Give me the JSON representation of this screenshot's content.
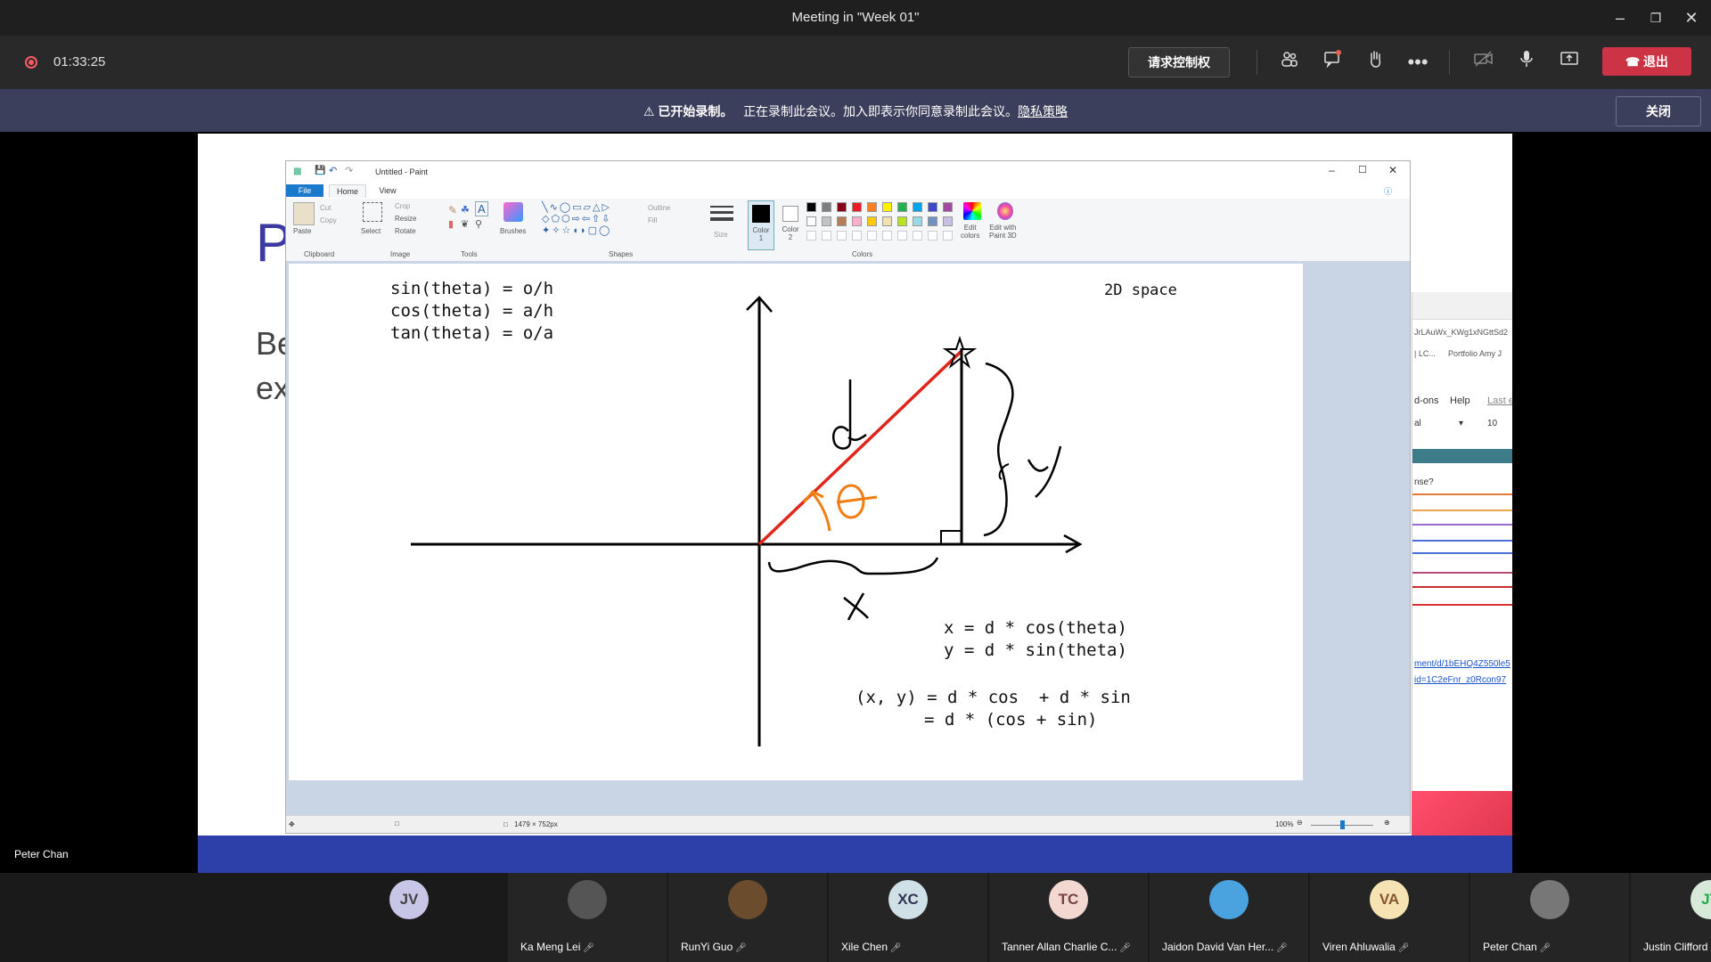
{
  "window": {
    "title": "Meeting in \"Week 01\""
  },
  "controls": {
    "timer": "01:33:25",
    "request_control": "请求控制权",
    "leave": "退出",
    "icons": [
      "participants-icon",
      "chat-icon",
      "raise-hand-icon",
      "more-icon",
      "camera-off-icon",
      "mic-icon",
      "share-icon"
    ]
  },
  "banner": {
    "bold": "已开始录制。",
    "text": "正在录制此会议。加入即表示你同意录制此会议。",
    "link": "隐私策略",
    "close": "关闭"
  },
  "slide": {
    "title_partial": "P",
    "line1": "Be",
    "line2": "ex",
    "overflow": {
      "url_fragment": "JrLAuWx_KWg1xNGttSd2",
      "bookmark1": "| LC...",
      "bookmark2": "Portfolio Amy J",
      "menu1": "d-ons",
      "menu2": "Help",
      "menu3": "Last e",
      "font": "al",
      "size": "10",
      "question": "nse?",
      "link1": "ment/d/1bEHQ4Z550le5",
      "link2": "id=1C2eFnr_z0Rcon97"
    }
  },
  "paint": {
    "title": "Untitled - Paint",
    "tabs": [
      "File",
      "Home",
      "View"
    ],
    "groups": {
      "clipboard": "Clipboard",
      "image": "Image",
      "tools": "Tools",
      "shapes": "Shapes",
      "colors": "Colors"
    },
    "buttons": {
      "paste": "Paste",
      "cut": "Cut",
      "copy": "Copy",
      "select": "Select",
      "crop": "Crop",
      "resize": "Resize",
      "rotate": "Rotate",
      "brushes": "Brushes",
      "outline": "Outline",
      "fill": "Fill",
      "size": "Size",
      "color1": "Color\n1",
      "color2": "Color\n2",
      "edit_colors": "Edit\ncolors",
      "edit_3d": "Edit with\nPaint 3D"
    },
    "palette": [
      "#000000",
      "#7f7f7f",
      "#880015",
      "#ed1c24",
      "#ff7f27",
      "#fff200",
      "#22b14c",
      "#00a2e8",
      "#3f48cc",
      "#a349a4",
      "#ffffff",
      "#c3c3c3",
      "#b97a57",
      "#ffaec9",
      "#ffc90e",
      "#efe4b0",
      "#b5e61d",
      "#99d9ea",
      "#7092be",
      "#c8bfe7"
    ],
    "status": {
      "dimensions": "1479 × 752px",
      "zoom": "100%"
    },
    "canvas_text": {
      "sin": "sin(theta) = o/h",
      "cos": "cos(theta) = a/h",
      "tan": "tan(theta) = o/a",
      "space": "2D space",
      "x_eq": "x = d * cos(theta)",
      "y_eq": "y = d * sin(theta)",
      "xy1": "(x, y) = d * cos  + d * sin",
      "xy2": "= d * (cos + sin)"
    }
  },
  "presenter_label": "Peter Chan",
  "participants": [
    {
      "initials": "JV",
      "name": "",
      "color": "#c8c6e6",
      "text_color": "#444"
    },
    {
      "initials": "",
      "name": "Ka Meng Lei",
      "color": "#555"
    },
    {
      "initials": "",
      "name": "RunYi Guo",
      "color": "#6b4d2e"
    },
    {
      "initials": "XC",
      "name": "Xile Chen",
      "color": "#cfe0e6",
      "text_color": "#335"
    },
    {
      "initials": "TC",
      "name": "Tanner Allan Charlie C...",
      "color": "#f2d8d0",
      "text_color": "#744"
    },
    {
      "initials": "",
      "name": "Jaidon David Van Her...",
      "color": "#4aa3df"
    },
    {
      "initials": "VA",
      "name": "Viren Ahluwalia",
      "color": "#f5e3b3",
      "text_color": "#853"
    },
    {
      "initials": "",
      "name": "Peter Chan",
      "color": "#777"
    },
    {
      "initials": "JT",
      "name": "Justin Clifford Tim",
      "color": "#d7ead9",
      "text_color": "#2a4"
    }
  ]
}
